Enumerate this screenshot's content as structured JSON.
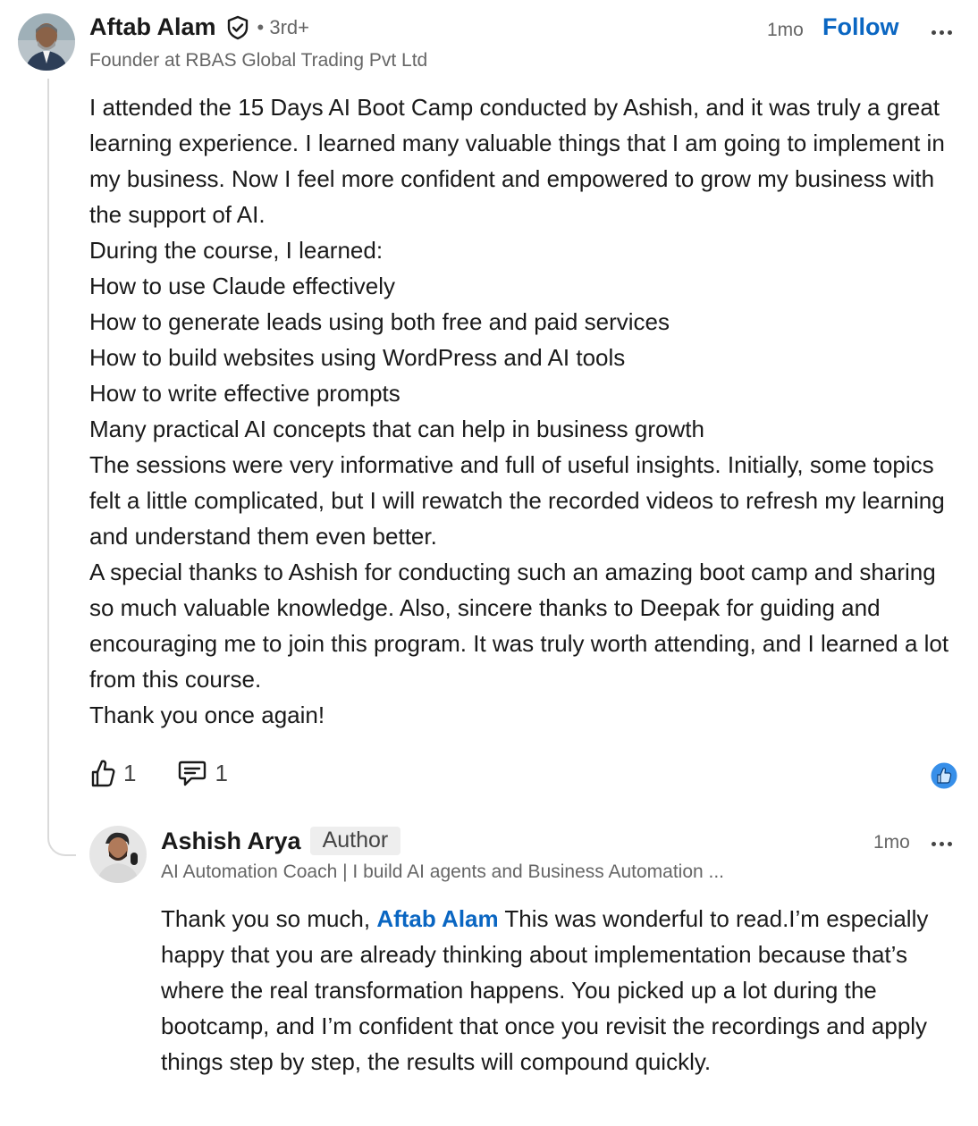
{
  "comment": {
    "author_name": "Aftab Alam",
    "degree": "• 3rd+",
    "headline": "Founder at RBAS Global Trading Pvt Ltd",
    "time": "1mo",
    "follow_label": "Follow",
    "paragraphs": [
      "I attended the 15 Days AI Boot Camp conducted by Ashish, and it was truly a great learning experience. I learned many valuable things that I am going to implement in my business. Now I feel more confident and empowered to grow my business with the support of AI.",
      "During the course, I learned:",
      "How to use Claude effectively",
      "How to generate leads using both free and paid services",
      "How to build websites using WordPress and AI tools",
      "How to write effective prompts",
      "Many practical AI concepts that can help in business growth",
      "The sessions were very informative and full of useful insights. Initially, some topics felt a little complicated, but I will rewatch the recorded videos to refresh my learning and understand them even better.",
      "A special thanks to Ashish for conducting such an amazing boot camp and sharing so much valuable knowledge. Also, sincere thanks to Deepak for guiding and encouraging me to join this program. It was truly worth attending, and I learned a lot from this course.",
      "Thank you once again!"
    ],
    "like_count": "1",
    "reply_count": "1"
  },
  "reply": {
    "author_name": "Ashish Arya",
    "author_badge": "Author",
    "headline": "AI Automation Coach | I build AI agents and Business Automation ...",
    "time": "1mo",
    "text_before_mention": "Thank you so much, ",
    "mention": "Aftab Alam",
    "text_after_mention": " This was wonderful to read.I’m especially happy that you are already thinking about implementation because that’s where the real transformation happens. You picked up a lot during the bootcamp, and I’m confident that once you revisit the recordings and apply things step by step, the results will compound quickly."
  },
  "icons": {
    "verified": "verified-shield-icon",
    "like": "thumbs-up-icon",
    "reply": "speech-bubble-icon",
    "reaction": "like-reaction-icon",
    "more": "more-options-icon"
  },
  "colors": {
    "link": "#0a66c2",
    "secondary_text": "#666666",
    "thread_line": "#dadada"
  }
}
